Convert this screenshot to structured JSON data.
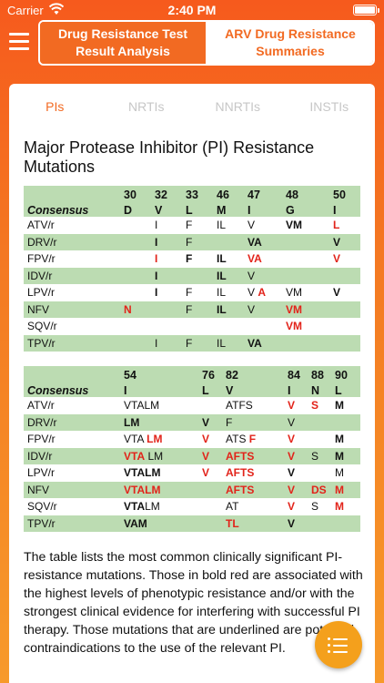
{
  "status": {
    "carrier": "Carrier",
    "time": "2:40 PM"
  },
  "header": {
    "segments": [
      {
        "label": "Drug Resistance Test Result Analysis"
      },
      {
        "label": "ARV Drug Resistance Summaries"
      }
    ]
  },
  "tabs": [
    "PIs",
    "NRTIs",
    "NNRTIs",
    "INSTIs"
  ],
  "title": "Major Protease Inhibitor (PI) Resistance Mutations",
  "consensus_label": "Consensus",
  "table1": {
    "positions": [
      "30",
      "32",
      "33",
      "46",
      "47",
      "48",
      "50"
    ],
    "consensus": [
      "D",
      "V",
      "L",
      "M",
      "I",
      "G",
      "I"
    ],
    "rows": [
      {
        "drug": "ATV/r",
        "cells": [
          [],
          [
            {
              "t": "I"
            }
          ],
          [
            {
              "t": "F"
            }
          ],
          [
            {
              "t": "IL"
            }
          ],
          [
            {
              "t": "V"
            }
          ],
          [
            {
              "t": "VM",
              "s": "b"
            }
          ],
          [
            {
              "t": "L",
              "s": "red"
            }
          ]
        ]
      },
      {
        "drug": "DRV/r",
        "cells": [
          [],
          [
            {
              "t": "I",
              "s": "b"
            }
          ],
          [
            {
              "t": "F"
            }
          ],
          [],
          [
            {
              "t": "VA",
              "s": "b"
            }
          ],
          [],
          [
            {
              "t": "V",
              "s": "b"
            }
          ]
        ]
      },
      {
        "drug": "FPV/r",
        "cells": [
          [],
          [
            {
              "t": "I",
              "s": "red"
            }
          ],
          [
            {
              "t": "F",
              "s": "b"
            }
          ],
          [
            {
              "t": "IL",
              "s": "b"
            }
          ],
          [
            {
              "t": "VA",
              "s": "red"
            }
          ],
          [],
          [
            {
              "t": "V",
              "s": "red"
            }
          ]
        ]
      },
      {
        "drug": "IDV/r",
        "cells": [
          [],
          [
            {
              "t": "I",
              "s": "b"
            }
          ],
          [],
          [
            {
              "t": "IL",
              "s": "b"
            }
          ],
          [
            {
              "t": "V"
            }
          ],
          [],
          []
        ]
      },
      {
        "drug": "LPV/r",
        "cells": [
          [],
          [
            {
              "t": "I",
              "s": "b"
            }
          ],
          [
            {
              "t": "F"
            }
          ],
          [
            {
              "t": "IL"
            }
          ],
          [
            {
              "t": "V "
            },
            {
              "t": "A",
              "s": "red"
            }
          ],
          [
            {
              "t": "VM"
            }
          ],
          [
            {
              "t": "V",
              "s": "b"
            }
          ]
        ]
      },
      {
        "drug": "NFV",
        "cells": [
          [
            {
              "t": "N",
              "s": "red"
            }
          ],
          [],
          [
            {
              "t": "F"
            }
          ],
          [
            {
              "t": "IL",
              "s": "b"
            }
          ],
          [
            {
              "t": "V"
            }
          ],
          [
            {
              "t": "VM",
              "s": "red"
            }
          ],
          []
        ]
      },
      {
        "drug": "SQV/r",
        "cells": [
          [],
          [],
          [],
          [],
          [],
          [
            {
              "t": "VM",
              "s": "red"
            }
          ],
          []
        ]
      },
      {
        "drug": "TPV/r",
        "cells": [
          [],
          [
            {
              "t": "I"
            }
          ],
          [
            {
              "t": "F"
            }
          ],
          [
            {
              "t": "IL"
            }
          ],
          [
            {
              "t": "VA",
              "s": "b"
            }
          ],
          [],
          []
        ]
      }
    ]
  },
  "table2": {
    "positions": [
      "54",
      "76",
      "82",
      "84",
      "88",
      "90"
    ],
    "consensus": [
      "I",
      "L",
      "V",
      "I",
      "N",
      "L"
    ],
    "rows": [
      {
        "drug": "ATV/r",
        "cells": [
          [
            {
              "t": "VTALM"
            }
          ],
          [],
          [
            {
              "t": "ATFS"
            }
          ],
          [
            {
              "t": "V",
              "s": "red"
            }
          ],
          [
            {
              "t": "S",
              "s": "red"
            }
          ],
          [
            {
              "t": "M",
              "s": "b"
            }
          ]
        ]
      },
      {
        "drug": "DRV/r",
        "cells": [
          [
            {
              "t": "LM",
              "s": "b"
            }
          ],
          [
            {
              "t": "V",
              "s": "b"
            }
          ],
          [
            {
              "t": "F"
            }
          ],
          [
            {
              "t": "V"
            }
          ],
          [],
          []
        ]
      },
      {
        "drug": "FPV/r",
        "cells": [
          [
            {
              "t": "VTA "
            },
            {
              "t": "LM",
              "s": "red"
            }
          ],
          [
            {
              "t": "V",
              "s": "red"
            }
          ],
          [
            {
              "t": "ATS "
            },
            {
              "t": "F",
              "s": "red"
            }
          ],
          [
            {
              "t": "V",
              "s": "red"
            }
          ],
          [],
          [
            {
              "t": "M",
              "s": "b"
            }
          ]
        ]
      },
      {
        "drug": "IDV/r",
        "cells": [
          [
            {
              "t": "VTA",
              "s": "red"
            },
            {
              "t": " LM"
            }
          ],
          [
            {
              "t": "V",
              "s": "red"
            }
          ],
          [
            {
              "t": "AFTS",
              "s": "red"
            }
          ],
          [
            {
              "t": "V",
              "s": "red"
            }
          ],
          [
            {
              "t": "S"
            }
          ],
          [
            {
              "t": "M",
              "s": "b"
            }
          ]
        ]
      },
      {
        "drug": "LPV/r",
        "cells": [
          [
            {
              "t": "VTALM",
              "s": "b"
            }
          ],
          [
            {
              "t": "V",
              "s": "red"
            }
          ],
          [
            {
              "t": "AFTS",
              "s": "red"
            }
          ],
          [
            {
              "t": "V",
              "s": "b"
            }
          ],
          [],
          [
            {
              "t": "M"
            }
          ]
        ]
      },
      {
        "drug": "NFV",
        "cells": [
          [
            {
              "t": "VTALM",
              "s": "red"
            }
          ],
          [],
          [
            {
              "t": "AFTS",
              "s": "red"
            }
          ],
          [
            {
              "t": "V",
              "s": "red"
            }
          ],
          [
            {
              "t": "DS",
              "s": "red"
            }
          ],
          [
            {
              "t": "M",
              "s": "red"
            }
          ]
        ]
      },
      {
        "drug": "SQV/r",
        "cells": [
          [
            {
              "t": "VTA",
              "s": "b"
            },
            {
              "t": "LM"
            }
          ],
          [],
          [
            {
              "t": "AT"
            }
          ],
          [
            {
              "t": "V",
              "s": "red"
            }
          ],
          [
            {
              "t": "S"
            }
          ],
          [
            {
              "t": "M",
              "s": "red"
            }
          ]
        ]
      },
      {
        "drug": "TPV/r",
        "cells": [
          [
            {
              "t": "VAM",
              "s": "b"
            }
          ],
          [],
          [
            {
              "t": "TL",
              "s": "red"
            }
          ],
          [
            {
              "t": "V",
              "s": "b"
            }
          ],
          [],
          []
        ]
      }
    ]
  },
  "description": "The table lists the most common clinically significant PI-resistance mutations. Those in bold red are associated with the highest levels of phenotypic resistance and/or with the strongest clinical evidence for interfering with successful PI therapy. Those mutations that are underlined are potential contraindications to the use of the relevant PI.",
  "colors": {
    "accent": "#f26a22",
    "table_green": "#bcdcb2",
    "red": "#e2231a",
    "fab": "#f4a01c"
  },
  "icons": {
    "menu": "hamburger-icon",
    "fab": "list-icon",
    "wifi": "wifi-icon",
    "battery": "battery-icon"
  }
}
